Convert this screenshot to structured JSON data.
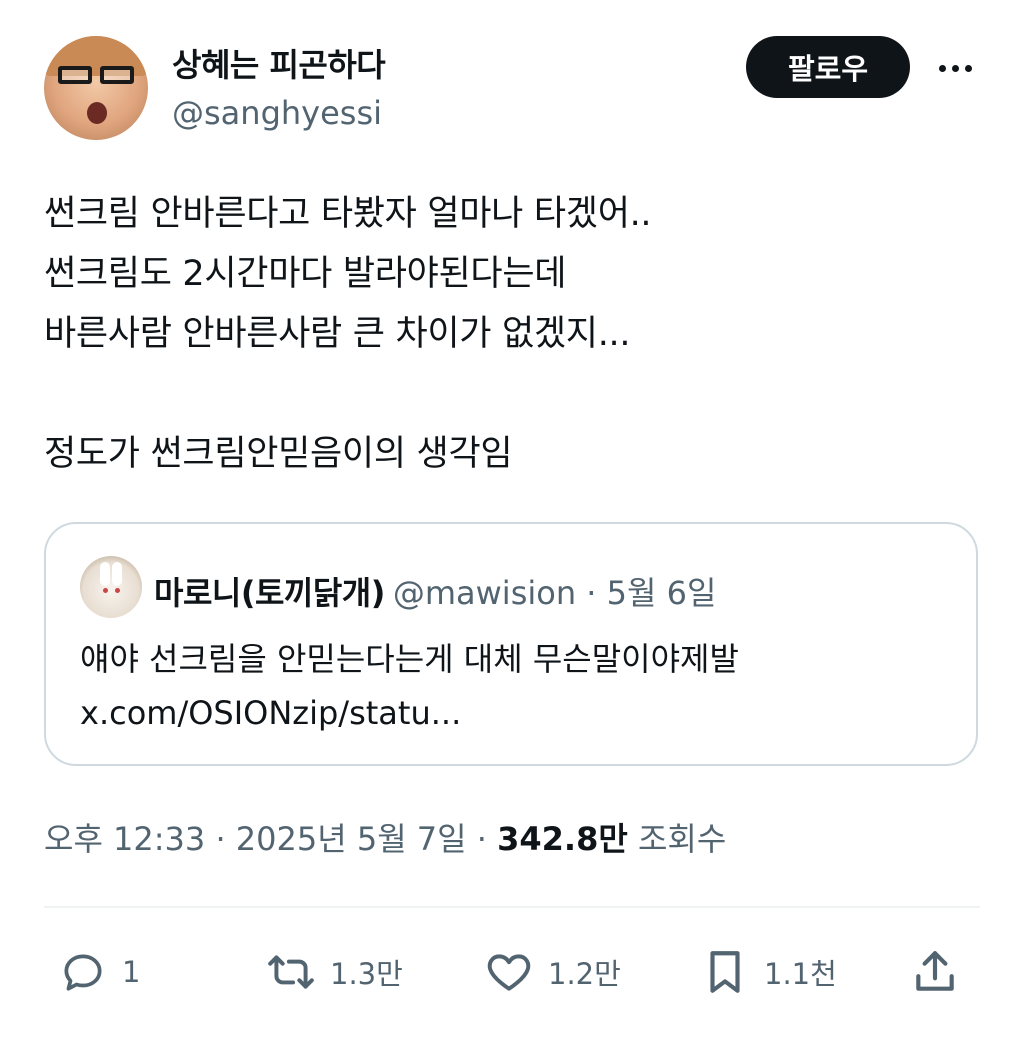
{
  "author": {
    "display_name": "상혜는 피곤하다",
    "handle": "@sanghyessi"
  },
  "follow_label": "팔로우",
  "tweet_lines": [
    "썬크림 안바른다고 타봤자 얼마나 타겠어..",
    "썬크림도 2시간마다 발라야된다는데",
    "바른사람 안바른사람 큰 차이가 없겠지...",
    "",
    "정도가 썬크림안믿음이의 생각임"
  ],
  "quote": {
    "display_name": "마로니(토끼닭개)",
    "handle_and_date": "@mawision · 5월 6일",
    "text": "얘야 선크림을 안믿는다는게 대체 무슨말이야제발",
    "link": "x.com/OSIONzip/statu..."
  },
  "meta": {
    "timestamp": "오후 12:33 · 2025년 5월 7일 · ",
    "views_count": "342.8만",
    "views_label": " 조회수"
  },
  "actions": {
    "replies": "1",
    "reposts": "1.3만",
    "likes": "1.2만",
    "bookmarks": "1.1천"
  },
  "colors": {
    "text": "#0f1419",
    "secondary": "#536471",
    "border": "#cfd9de"
  }
}
